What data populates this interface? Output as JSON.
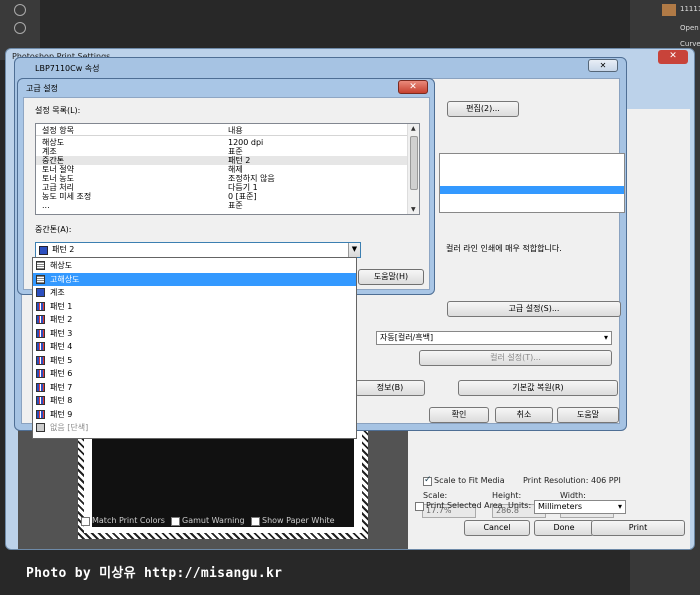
{
  "photoshop": {
    "panel_items": [
      "1111120...",
      "Open",
      "Curves"
    ]
  },
  "print_settings": {
    "title": "Photoshop Print Settings",
    "scale_label": "Scale:",
    "scale_value": "17.7%",
    "height_label": "Height:",
    "height_value": "286.8",
    "width_label": "Width:",
    "width_value": "190.8",
    "scale_to_fit_label": "Scale to Fit Media",
    "print_resolution": "Print Resolution: 406 PPI",
    "print_selected_area": "Print Selected Area",
    "units_label": "Units:",
    "units_value": "Millimeters",
    "cancel": "Cancel",
    "done": "Done",
    "print": "Print",
    "match_print_colors": "Match Print Colors",
    "gamut_warning": "Gamut Warning",
    "show_paper_white": "Show Paper White"
  },
  "lbp_dialog": {
    "title": "LBP7110Cw 속성",
    "edit_button": "편집(2)...",
    "description": "컬러 라인 인쇄에 매우 적합합니다.",
    "advanced_button": "고급 설정(S)...",
    "color_mode_value": "자동[컬러/흑백]",
    "color_settings_button": "컬러 설정(T)...",
    "info_button": "정보(B)",
    "restore_defaults_button": "기본값 복원(R)",
    "ok_button": "확인",
    "cancel_button": "취소",
    "help_button": "도움말"
  },
  "advanced_dialog": {
    "title": "고급 설정",
    "list_label": "설정 목록(L):",
    "col_item": "설정 항목",
    "col_value": "내용",
    "rows": [
      {
        "item": "해상도",
        "value": "1200 dpi"
      },
      {
        "item": "계조",
        "value": "표준"
      },
      {
        "item": "중간톤",
        "value": "패턴 2"
      },
      {
        "item": "토너 절약",
        "value": "해제"
      },
      {
        "item": "토너 농도",
        "value": "조정하지 않음"
      },
      {
        "item": "고급 처리",
        "value": "다듬기 1"
      },
      {
        "item": "농도 미세 조정",
        "value": "0 [표준]"
      },
      {
        "item": "...",
        "value": "표준"
      }
    ],
    "halftone_label": "중간톤(A):",
    "halftone_value": "패턴 2",
    "help_button": "도움말(H)",
    "options": [
      {
        "label": "해상도",
        "icon": "res",
        "selected": false,
        "disabled": false
      },
      {
        "label": "고해상도",
        "icon": "res",
        "selected": true,
        "disabled": false
      },
      {
        "label": "계조",
        "icon": "tone",
        "selected": false,
        "disabled": false
      },
      {
        "label": "패턴 1",
        "icon": "pattern",
        "selected": false,
        "disabled": false
      },
      {
        "label": "패턴 2",
        "icon": "pattern",
        "selected": false,
        "disabled": false
      },
      {
        "label": "패턴 3",
        "icon": "pattern",
        "selected": false,
        "disabled": false
      },
      {
        "label": "패턴 4",
        "icon": "pattern",
        "selected": false,
        "disabled": false
      },
      {
        "label": "패턴 5",
        "icon": "pattern",
        "selected": false,
        "disabled": false
      },
      {
        "label": "패턴 6",
        "icon": "pattern",
        "selected": false,
        "disabled": false
      },
      {
        "label": "패턴 7",
        "icon": "pattern",
        "selected": false,
        "disabled": false
      },
      {
        "label": "패턴 8",
        "icon": "pattern",
        "selected": false,
        "disabled": false
      },
      {
        "label": "패턴 9",
        "icon": "pattern",
        "selected": false,
        "disabled": false
      },
      {
        "label": "없음 [단색]",
        "icon": "none",
        "selected": false,
        "disabled": true
      }
    ]
  },
  "watermark": "Photo by 미상유  http://misangu.kr"
}
